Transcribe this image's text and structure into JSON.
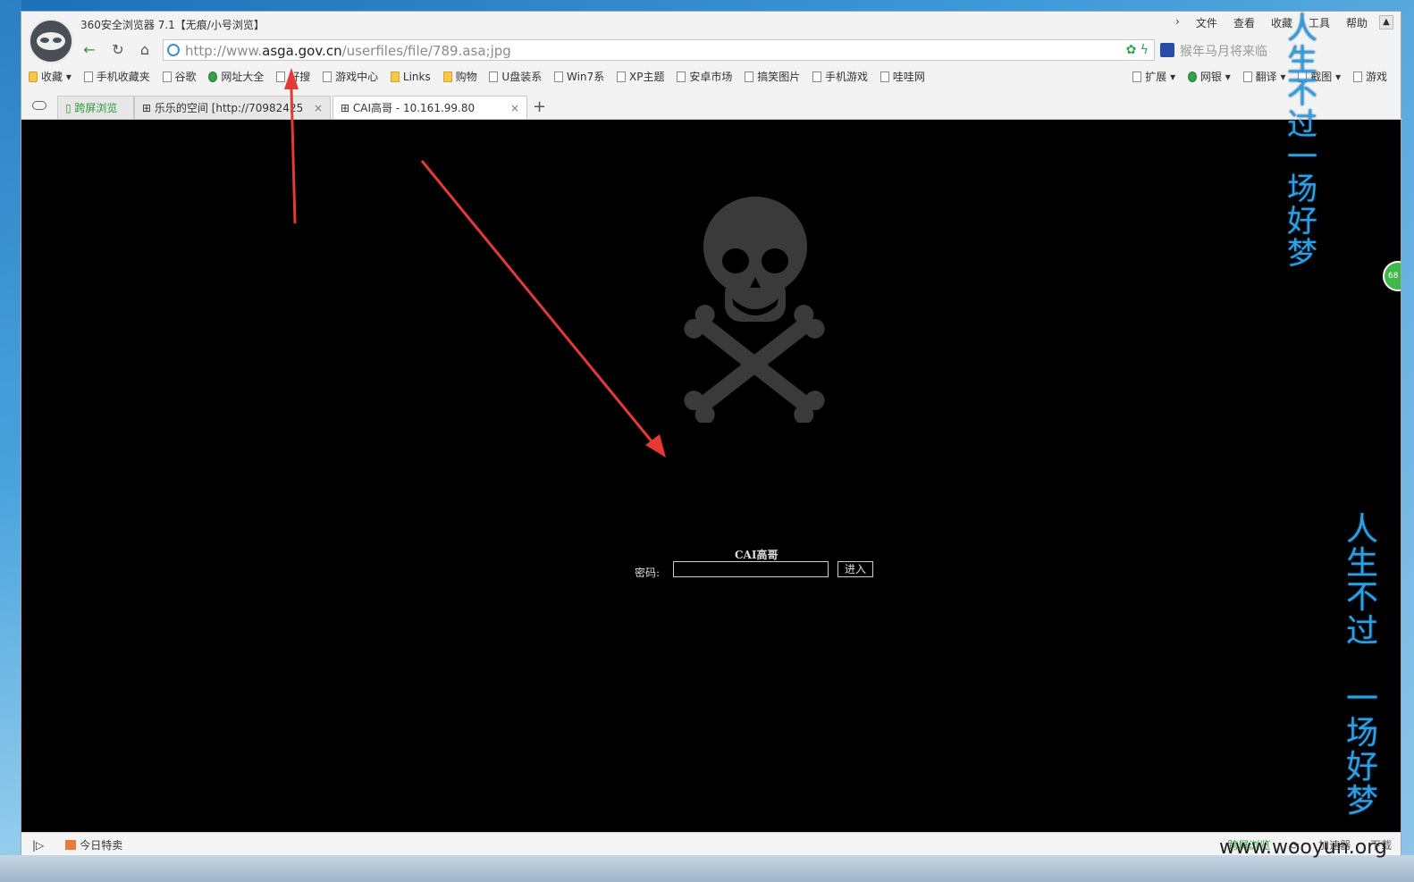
{
  "window": {
    "title": "360安全浏览器 7.1【无痕/小号浏览】"
  },
  "menu": [
    "文件",
    "查看",
    "收藏",
    "工具",
    "帮助"
  ],
  "address": {
    "prefix": "http://www.",
    "domain": "asga.gov.cn",
    "path": "/userfiles/file/789.asa;jpg"
  },
  "search": {
    "placeholder": "猴年马月将来临"
  },
  "bookmarks": {
    "left": [
      {
        "label": "收藏",
        "icon": "star"
      },
      {
        "label": "手机收藏夹",
        "icon": "phone"
      },
      {
        "label": "谷歌",
        "icon": "page"
      },
      {
        "label": "网址大全",
        "icon": "plus"
      },
      {
        "label": "好搜",
        "icon": "page"
      },
      {
        "label": "游戏中心",
        "icon": "gamepad"
      },
      {
        "label": "Links",
        "icon": "folder"
      },
      {
        "label": "购物",
        "icon": "folder"
      },
      {
        "label": "U盘装系",
        "icon": "page"
      },
      {
        "label": "Win7系",
        "icon": "page"
      },
      {
        "label": "XP主题",
        "icon": "page"
      },
      {
        "label": "安卓市场",
        "icon": "page"
      },
      {
        "label": "搞笑图片",
        "icon": "page"
      },
      {
        "label": "手机游戏",
        "icon": "page"
      },
      {
        "label": "哇哇网",
        "icon": "page"
      }
    ],
    "right": [
      "扩展",
      "网银",
      "翻译",
      "截图",
      "游戏"
    ]
  },
  "tabs": [
    {
      "label": "跨屏浏览",
      "active": false
    },
    {
      "label": "乐乐的空间 [http://70982425",
      "active": false
    },
    {
      "label": "CAI高哥 - 10.161.99.80",
      "active": true
    }
  ],
  "page": {
    "login_title": "CAI高哥",
    "password_label": "密码:",
    "enter_button": "进入",
    "badge": "68"
  },
  "status_bar": {
    "left": "今日特卖",
    "right": [
      "跨屏浏览",
      "加速器",
      "下载"
    ]
  },
  "overlay": {
    "vertical_text_1": "人生不过一场好梦",
    "vertical_text_2": "人生不过 一场好梦",
    "watermark": "www.wooyun.org"
  },
  "colors": {
    "page_bg": "#000000",
    "annotation_arrow": "#e53935",
    "overlay_text": "#2f9fe0"
  }
}
